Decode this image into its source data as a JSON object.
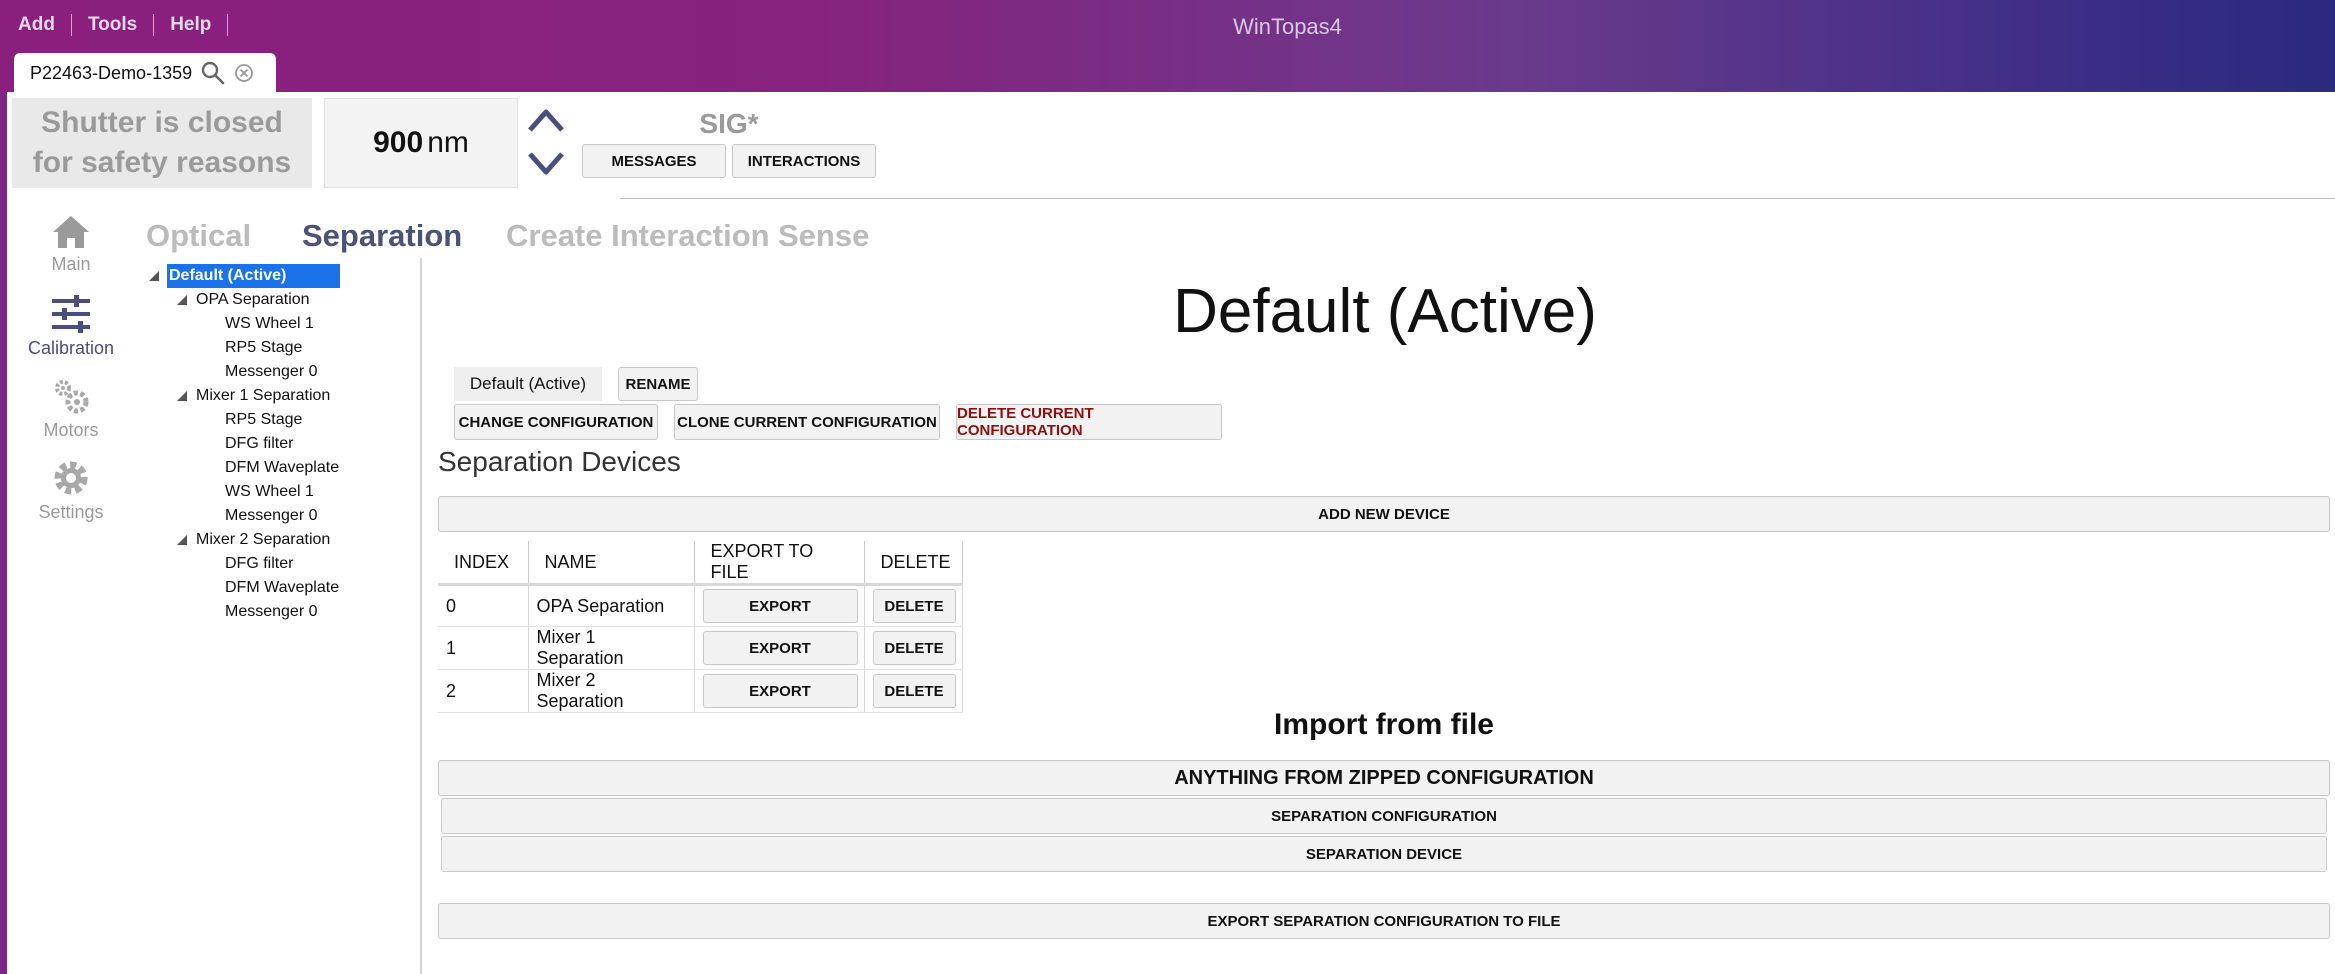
{
  "menu": {
    "items": [
      "Add",
      "Tools",
      "Help"
    ]
  },
  "app": {
    "title": "WinTopas4"
  },
  "tab": {
    "label": "P22463-Demo-1359"
  },
  "header": {
    "shutter_line1": "Shutter is closed",
    "shutter_line2": "for safety reasons",
    "wavelength_value": "900",
    "wavelength_unit": "nm",
    "signal": "SIG*",
    "messages_label": "MESSAGES",
    "interactions_label": "INTERACTIONS"
  },
  "sidebar": {
    "items": [
      {
        "label": "Main",
        "icon": "home-icon"
      },
      {
        "label": "Calibration",
        "icon": "sliders-icon"
      },
      {
        "label": "Motors",
        "icon": "gears-icon"
      },
      {
        "label": "Settings",
        "icon": "gear-icon"
      }
    ]
  },
  "page_tabs": [
    "Optical",
    "Separation",
    "Create Interaction",
    "Sense"
  ],
  "tree": {
    "root": "Default (Active)",
    "groups": [
      {
        "label": "OPA Separation",
        "children": [
          "WS Wheel 1",
          "RP5 Stage",
          "Messenger 0"
        ]
      },
      {
        "label": "Mixer 1 Separation",
        "children": [
          "RP5 Stage",
          "DFG filter",
          "DFM Waveplate",
          "WS Wheel 1",
          "Messenger 0"
        ]
      },
      {
        "label": "Mixer 2 Separation",
        "children": [
          "DFG filter",
          "DFM Waveplate",
          "Messenger 0"
        ]
      }
    ]
  },
  "main": {
    "title": "Default (Active)",
    "config_name": "Default (Active)",
    "rename_label": "RENAME",
    "change_label": "CHANGE CONFIGURATION",
    "clone_label": "CLONE CURRENT CONFIGURATION",
    "delete_config_label": "DELETE CURRENT CONFIGURATION",
    "section_title": "Separation Devices",
    "add_device_label": "ADD NEW DEVICE",
    "table": {
      "columns": [
        "INDEX",
        "NAME",
        "EXPORT TO FILE",
        "DELETE"
      ],
      "rows": [
        {
          "index": "0",
          "name": "OPA Separation",
          "export": "EXPORT",
          "delete": "DELETE"
        },
        {
          "index": "1",
          "name": "Mixer 1 Separation",
          "export": "EXPORT",
          "delete": "DELETE"
        },
        {
          "index": "2",
          "name": "Mixer 2 Separation",
          "export": "EXPORT",
          "delete": "DELETE"
        }
      ]
    },
    "import_title": "Import from file",
    "import_zipped_label": "ANYTHING FROM ZIPPED CONFIGURATION",
    "import_config_label": "SEPARATION CONFIGURATION",
    "import_device_label": "SEPARATION DEVICE",
    "export_config_label": "EXPORT SEPARATION CONFIGURATION TO FILE"
  },
  "colors": {
    "accent": "#1a73e8",
    "danger_text": "#8b1010",
    "active_tab": "#4a5278",
    "titlebar_start": "#8a1f7d",
    "titlebar_end": "#2a2a7e"
  }
}
